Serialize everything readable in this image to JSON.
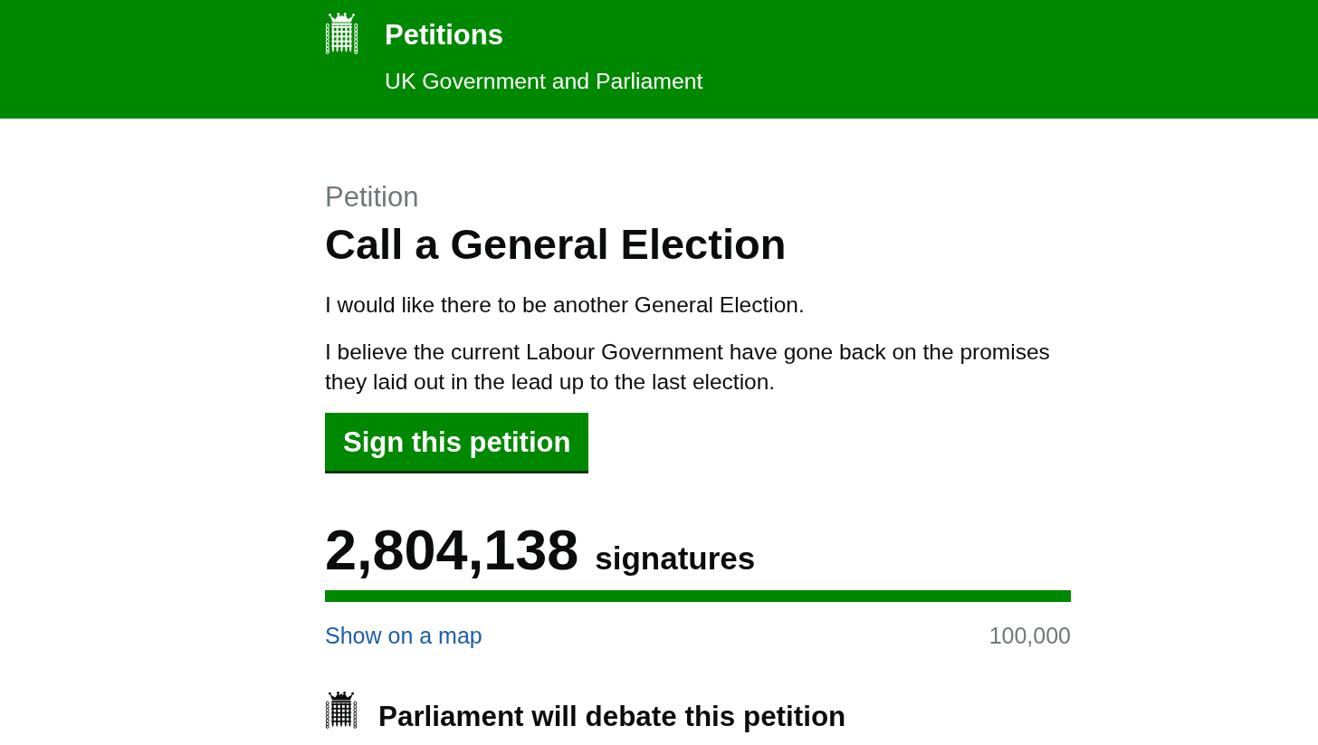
{
  "header": {
    "title": "Petitions",
    "subtitle": "UK Government and Parliament"
  },
  "petition": {
    "label": "Petition",
    "title": "Call a General Election",
    "paragraphs": [
      "I would like there to be another General Election.",
      "I believe the current Labour Government have gone back on the promises they laid out in the lead up to the last election."
    ],
    "sign_button": "Sign this petition"
  },
  "signatures": {
    "count": "2,804,138",
    "unit": "signatures",
    "progress": {
      "level": 1
    },
    "map_link": "Show on a map",
    "threshold": "100,000"
  },
  "debate": {
    "text": "Parliament will debate this petition"
  }
}
